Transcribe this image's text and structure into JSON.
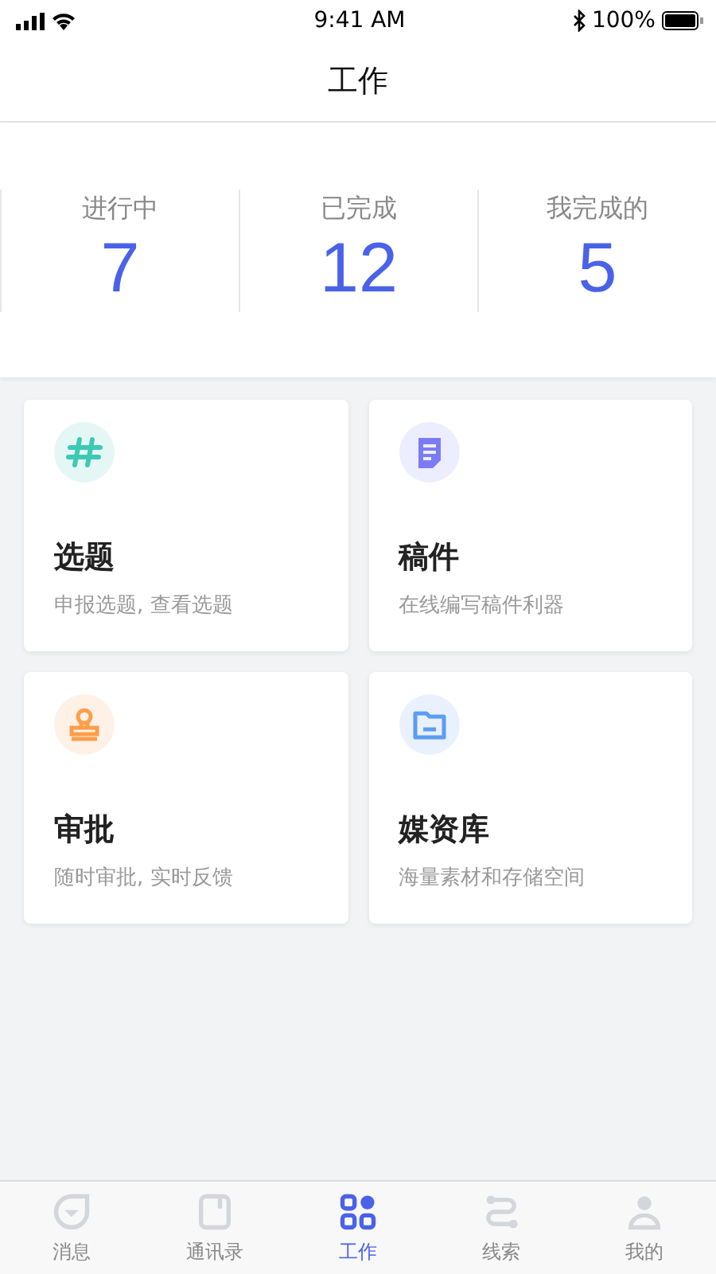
{
  "status_bar": {
    "time": "9:41 AM",
    "battery": "100%"
  },
  "header": {
    "title": "工作"
  },
  "stats": [
    {
      "label": "进行中",
      "value": "7"
    },
    {
      "label": "已完成",
      "value": "12"
    },
    {
      "label": "我完成的",
      "value": "5"
    }
  ],
  "cards": [
    {
      "title": "选题",
      "subtitle": "申报选题, 查看选题",
      "color": "#3ec9b5"
    },
    {
      "title": "稿件",
      "subtitle": "在线编写稿件利器",
      "color": "#7b7cf5"
    },
    {
      "title": "审批",
      "subtitle": "随时审批, 实时反馈",
      "color": "#ff9d4a"
    },
    {
      "title": "媒资库",
      "subtitle": "海量素材和存储空间",
      "color": "#5b9cf4"
    }
  ],
  "tabs": [
    {
      "label": "消息",
      "selected": false
    },
    {
      "label": "通讯录",
      "selected": false
    },
    {
      "label": "工作",
      "selected": true
    },
    {
      "label": "线索",
      "selected": false
    },
    {
      "label": "我的",
      "selected": false
    }
  ]
}
